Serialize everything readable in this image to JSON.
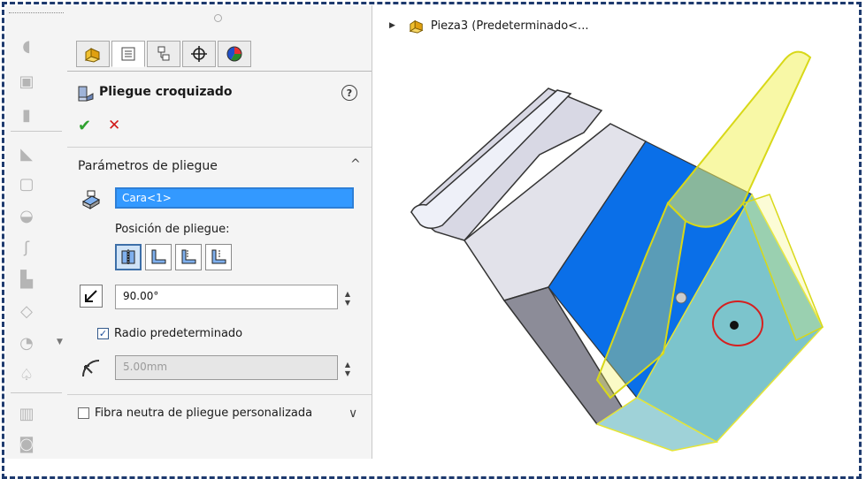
{
  "feature": {
    "title": "Pliegue croquizado",
    "help": "?",
    "ok": "✔",
    "cancel": "✕"
  },
  "group": {
    "title": "Parámetros de pliegue",
    "collapse": "^",
    "face_value": "Cara<1>",
    "position_label": "Posición de pliegue:",
    "angle_value": "90.00°",
    "default_radius_label": "Radio predeterminado",
    "default_radius_checked": true,
    "radius_value": "5.00mm"
  },
  "neutral_fiber": {
    "label": "Fibra neutra de pliegue personalizada",
    "checked": false,
    "expand": "∨"
  },
  "tree": {
    "expander": "▶",
    "part_label": "Pieza3  (Predeterminado<..."
  },
  "colors": {
    "accent_selection": "#3399ff",
    "highlight_yellow": "#f2f25c",
    "face_blue": "#0a6fe8",
    "face_teal": "#7cc4cc",
    "marker_red": "#d61f1f"
  }
}
